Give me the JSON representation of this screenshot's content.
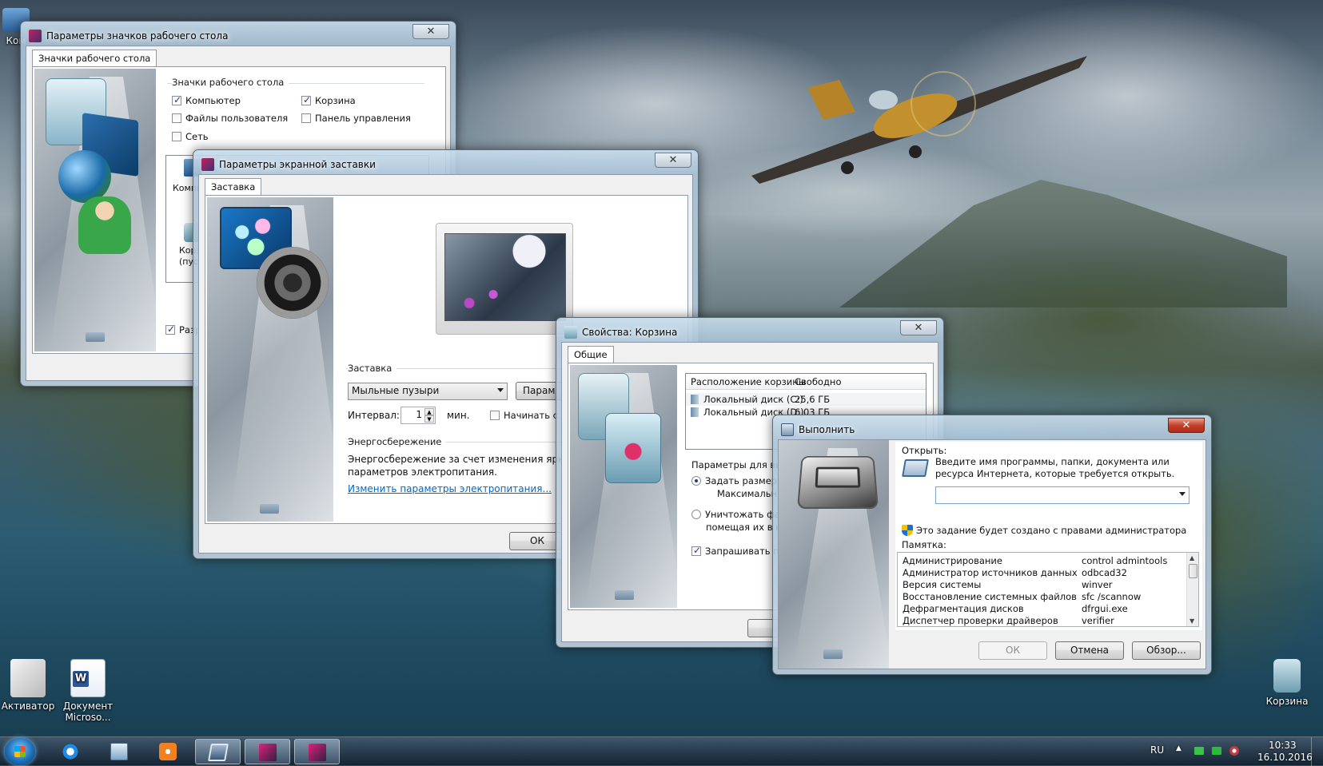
{
  "desktop": {
    "icons": [
      {
        "label": "Ком",
        "icon": "computer-icon"
      },
      {
        "label": "Активатор",
        "icon": "activator-icon"
      },
      {
        "label": "Документ Microso...",
        "icon": "word-document-icon"
      },
      {
        "label": "Корзина",
        "icon": "recycle-bin-icon"
      }
    ]
  },
  "win_icons": {
    "title": "Параметры значков рабочего стола",
    "tab": "Значки рабочего стола",
    "group_label": "Значки рабочего стола",
    "checkboxes": [
      {
        "label": "Компьютер",
        "checked": true
      },
      {
        "label": "Корзина",
        "checked": true
      },
      {
        "label": "Файлы пользователя",
        "checked": false
      },
      {
        "label": "Панель управления",
        "checked": false
      },
      {
        "label": "Сеть",
        "checked": false
      }
    ],
    "partial_labels": [
      "Компь",
      "Корз",
      "(пус",
      "Разр"
    ],
    "close_glyph": "✕"
  },
  "win_screensaver": {
    "title": "Параметры экранной заставки",
    "tab": "Заставка",
    "section_label": "Заставка",
    "selected_saver": "Мыльные пузыри",
    "params_button": "Парам",
    "interval_label": "Интервал:",
    "interval_value": "1",
    "interval_unit": "мин.",
    "start_label": "Начинать с",
    "power_label": "Энергосбережение",
    "power_text_1": "Энергосбережение за счет изменения яркости",
    "power_text_2": "параметров электропитания.",
    "power_link": "Изменить параметры электропитания...",
    "ok_button": "ОК",
    "close_glyph": "✕"
  },
  "win_recycle": {
    "title": "Свойства: Корзина",
    "tab": "Общие",
    "columns": [
      "Расположение корзины",
      "Свободно"
    ],
    "rows": [
      {
        "location": "Локальный диск (C:)",
        "free": "25,6 ГБ"
      },
      {
        "location": "Локальный диск (D:)",
        "free": "6,03 ГБ"
      }
    ],
    "params_label": "Параметры для вы",
    "radio_custom": "Задать размер:",
    "max_label": "Максимальн",
    "radio_destroy_1": "Уничтожать фай",
    "radio_destroy_2": "помещая их в ко",
    "confirm_label": "Запрашивать по",
    "close_glyph": "✕"
  },
  "win_run": {
    "title": "Выполнить",
    "open_label": "Открыть:",
    "description": "Введите имя программы, папки, документа или ресурса Интернета, которые требуется открыть.",
    "input_value": "",
    "admin_note": "Это задание будет создано с правами администратора",
    "memo_label": "Памятка:",
    "memo_rows": [
      {
        "name": "Администрирование",
        "cmd": "control admintools"
      },
      {
        "name": "Администратор источников данных",
        "cmd": "odbcad32"
      },
      {
        "name": "Версия системы",
        "cmd": "winver"
      },
      {
        "name": "Восстановление системных файлов",
        "cmd": "sfc /scannow"
      },
      {
        "name": "Дефрагментация дисков",
        "cmd": "dfrgui.exe"
      },
      {
        "name": "Диспетчер проверки драйверов",
        "cmd": "verifier"
      }
    ],
    "ok_button": "ОК",
    "cancel_button": "Отмена",
    "browse_button": "Обзор...",
    "close_glyph": "✕"
  },
  "taskbar": {
    "pinned": [
      {
        "name": "internet-explorer-icon"
      },
      {
        "name": "file-explorer-icon"
      },
      {
        "name": "media-player-icon"
      },
      {
        "name": "run-dialog-icon",
        "active": true
      },
      {
        "name": "personalization-icon"
      },
      {
        "name": "personalization-icon-2"
      }
    ],
    "language": "RU",
    "time": "10:33",
    "date": "16.10.2016"
  },
  "colors": {
    "link": "#0066cc",
    "close_red": "#c4402a",
    "title_glass": "#b4c8dc"
  }
}
